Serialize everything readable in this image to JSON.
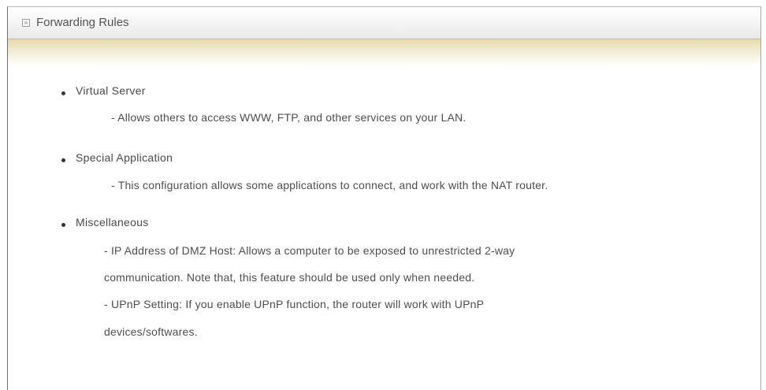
{
  "panel": {
    "title": "Forwarding Rules",
    "title_icon": "square-bullet-icon"
  },
  "items": [
    {
      "heading": "Virtual Server",
      "lines": [
        "- Allows others to access WWW, FTP, and other services on your LAN."
      ]
    },
    {
      "heading": "Special Application",
      "lines": [
        "- This configuration allows some applications to connect, and work with the NAT router."
      ]
    },
    {
      "heading": "Miscellaneous",
      "lines": [
        "- IP Address of DMZ Host: Allows a computer to be exposed to unrestricted 2-way",
        "communication. Note that, this feature should be used only when needed.",
        "- UPnP Setting: If you enable UPnP function, the router will work with UPnP",
        "devices/softwares."
      ]
    }
  ]
}
